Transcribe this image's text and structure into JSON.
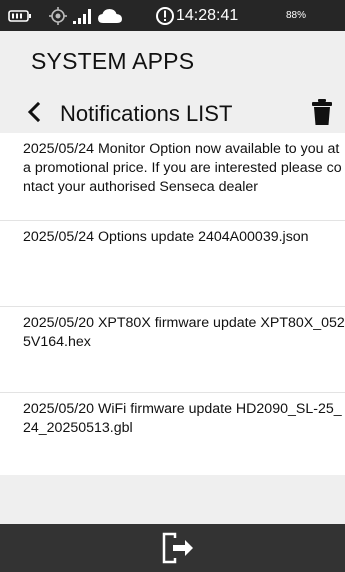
{
  "status_bar": {
    "icons": [
      "battery-outline-icon",
      "gps-icon",
      "signal-icon",
      "cloud-icon",
      "alert-icon"
    ],
    "time": "14:28:41",
    "battery_percent": "88%"
  },
  "app": {
    "title": "SYSTEM APPS"
  },
  "nav": {
    "title": "Notifications LIST",
    "back_icon": "chevron-left-icon",
    "delete_icon": "trash-icon"
  },
  "notifications": [
    {
      "text": "2025/05/24 Monitor Option now available to you at a promotional price. If you are interested please contact your authorised Senseca dealer"
    },
    {
      "text": "2025/05/24 Options update 2404A00039.json"
    },
    {
      "text": "2025/05/20 XPT80X firmware update XPT80X_0525V164.hex"
    },
    {
      "text": "2025/05/20 WiFi firmware update HD2090_SL-25_24_20250513.gbl"
    }
  ],
  "bottom_bar": {
    "exit_icon": "exit-icon"
  },
  "colors": {
    "status_bar_bg": "#262626",
    "page_bg": "#efefef",
    "list_bg": "#ffffff",
    "bottom_bar_bg": "#333333",
    "icon_white": "#ffffff",
    "text": "#111111"
  }
}
